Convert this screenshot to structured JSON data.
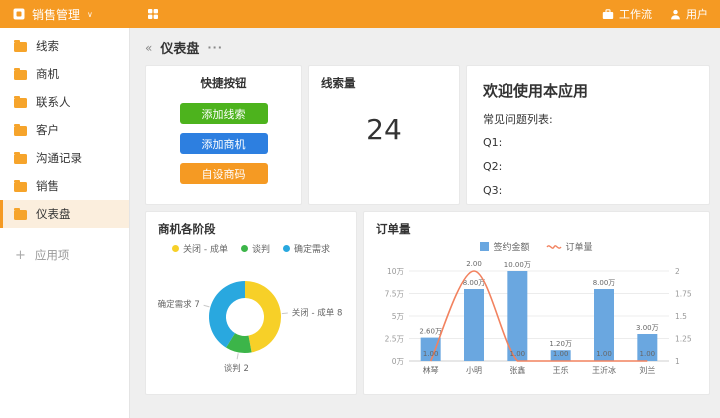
{
  "topbar": {
    "app_title": "销售管理",
    "nav": [
      {
        "label": "工作流",
        "icon": "briefcase-icon"
      },
      {
        "label": "用户",
        "icon": "user-icon"
      }
    ]
  },
  "sidebar": {
    "items": [
      {
        "label": "线索",
        "active": false
      },
      {
        "label": "商机",
        "active": false
      },
      {
        "label": "联系人",
        "active": false
      },
      {
        "label": "客户",
        "active": false
      },
      {
        "label": "沟通记录",
        "active": false
      },
      {
        "label": "销售",
        "active": false
      },
      {
        "label": "仪表盘",
        "active": true
      }
    ],
    "add_app_label": "应用项"
  },
  "page": {
    "title": "仪表盘",
    "collapse_glyph": "«",
    "more_glyph": "···"
  },
  "cards": {
    "quick": {
      "title": "快捷按钮",
      "buttons": [
        {
          "label": "添加线索",
          "color": "#4db31d"
        },
        {
          "label": "添加商机",
          "color": "#2d7fe0"
        },
        {
          "label": "自设商码",
          "color": "#f59a23"
        }
      ]
    },
    "leads": {
      "title": "线索量",
      "value": "24"
    },
    "welcome": {
      "title": "欢迎使用本应用",
      "subtitle": "常见问题列表:",
      "questions": [
        "Q1:",
        "Q2:",
        "Q3:"
      ]
    }
  },
  "chart_data": [
    {
      "type": "pie",
      "donut": true,
      "title": "商机各阶段",
      "legend_position": "top",
      "slices": [
        {
          "name": "关闭 - 成单",
          "value": 8,
          "color": "#f7d028"
        },
        {
          "name": "谈判",
          "value": 2,
          "color": "#3cb549"
        },
        {
          "name": "确定需求",
          "value": 7,
          "color": "#29a8df"
        }
      ]
    },
    {
      "type": "bar",
      "title": "订单量",
      "legend_position": "top",
      "grid": true,
      "categories": [
        "林琴",
        "小明",
        "张鑫",
        "王乐",
        "王沂冰",
        "刘兰"
      ],
      "series": [
        {
          "name": "签约金额",
          "kind": "bar",
          "axis": "left",
          "color": "#6aa7e0",
          "values": [
            2.6,
            8,
            10,
            1.2,
            8,
            3
          ],
          "labels": [
            "2.60万",
            "8.00万",
            "10.00万",
            "1.20万",
            "8.00万",
            "3.00万"
          ]
        },
        {
          "name": "订单量",
          "kind": "line",
          "axis": "right",
          "color": "#f2825f",
          "values": [
            1,
            2,
            1,
            1,
            1,
            1
          ],
          "labels": [
            "1.00",
            "2.00",
            "1.00",
            "1.00",
            "1.00",
            "1.00"
          ]
        }
      ],
      "y_left": {
        "min": 0,
        "max": 10,
        "ticks_top_down": [
          "10万",
          "7.5万",
          "5万",
          "2.5万",
          "0万"
        ]
      },
      "y_right": {
        "min": 1,
        "max": 2,
        "ticks_top_down": [
          "2",
          "1.75",
          "1.5",
          "1.25",
          "1"
        ]
      }
    }
  ]
}
